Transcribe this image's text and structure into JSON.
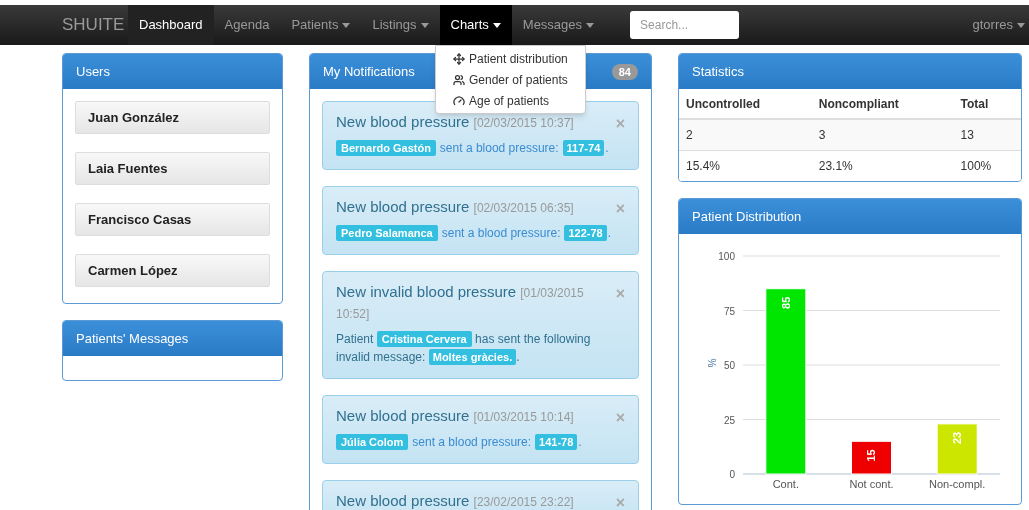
{
  "navbar": {
    "brand": "SHUITE",
    "items": [
      {
        "label": "Dashboard",
        "dropdown": false,
        "selected": true,
        "open": false
      },
      {
        "label": "Agenda",
        "dropdown": false,
        "selected": false,
        "open": false
      },
      {
        "label": "Patients",
        "dropdown": true,
        "selected": false,
        "open": false
      },
      {
        "label": "Listings",
        "dropdown": true,
        "selected": false,
        "open": false
      },
      {
        "label": "Charts",
        "dropdown": true,
        "selected": false,
        "open": true
      },
      {
        "label": "Messages",
        "dropdown": true,
        "selected": false,
        "open": false
      }
    ],
    "search": {
      "placeholder": "Search..."
    },
    "user": {
      "label": "gtorres",
      "dropdown": true
    }
  },
  "charts_menu": {
    "items": [
      {
        "label": "Patient distribution"
      },
      {
        "label": "Gender of patients"
      },
      {
        "label": "Age of patients"
      }
    ]
  },
  "users_panel": {
    "title": "Users",
    "users": [
      "Juan González",
      "Laia Fuentes",
      "Francisco Casas",
      "Carmen López"
    ]
  },
  "patients_messages_panel": {
    "title": "Patients' Messages"
  },
  "notifications_panel": {
    "title": "My Notifications",
    "count": "84",
    "close": "×",
    "notifications": [
      {
        "kind": "reading",
        "title": "New blood pressure",
        "time": "[02/03/2015 10:37]",
        "patient": "Bernardo Gastón",
        "text": "sent a blood pressure:",
        "value": "117-74",
        "end": "."
      },
      {
        "kind": "reading",
        "title": "New blood pressure",
        "time": "[02/03/2015 06:35]",
        "patient": "Pedro Salamanca",
        "text": "sent a blood pressure:",
        "value": "122-78",
        "end": "."
      },
      {
        "kind": "invalid",
        "title": "New invalid blood pressure",
        "time": "[01/03/2015 10:52]",
        "prefix": "Patient",
        "patient": "Cristina Cervera",
        "text": "has sent the following invalid message:",
        "value": "Moltes gràcies.",
        "end": "."
      },
      {
        "kind": "reading",
        "title": "New blood pressure",
        "time": "[01/03/2015 10:14]",
        "patient": "Júlia Colom",
        "text": "sent a blood pressure:",
        "value": "141-78",
        "end": "."
      },
      {
        "kind": "reading",
        "title": "New blood pressure",
        "time": "[23/02/2015 23:22]"
      }
    ]
  },
  "statistics_panel": {
    "title": "Statistics",
    "columns": [
      "Uncontrolled",
      "Noncompliant",
      "Total"
    ],
    "rows": [
      [
        "2",
        "3",
        "13"
      ],
      [
        "15.4%",
        "23.1%",
        "100%"
      ]
    ]
  },
  "distribution_panel": {
    "title": "Patient Distribution",
    "chart_data": {
      "type": "bar",
      "ylabel": "%",
      "categories": [
        "Cont.",
        "Not cont.",
        "Non-compl."
      ],
      "series": [
        {
          "color": "#00e600",
          "values": [
            85,
            null,
            null
          ]
        },
        {
          "color": "#ee0000",
          "values": [
            null,
            15,
            null
          ]
        },
        {
          "color": "#cce600",
          "values": [
            null,
            null,
            23
          ]
        }
      ],
      "stacked": true,
      "grid": true,
      "ylim": [
        0,
        100
      ],
      "yticks": [
        0,
        25,
        50,
        75,
        100
      ],
      "data_labels": true
    }
  }
}
